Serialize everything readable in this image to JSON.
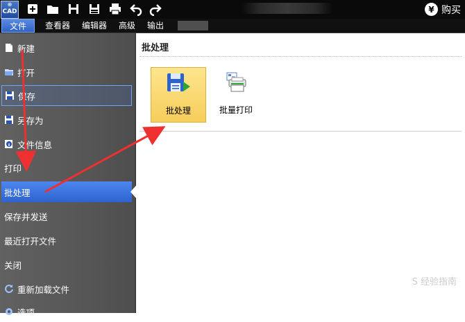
{
  "titlebar": {
    "logo_top": "⊕",
    "logo_text": "CAD",
    "buy_symbol": "¥",
    "buy_label": "购买",
    "icons": [
      "new-icon",
      "open-icon",
      "save-icon",
      "save-as-icon",
      "print-icon",
      "undo-icon",
      "redo-icon"
    ]
  },
  "menubar": {
    "items": [
      "文件",
      "查看器",
      "编辑器",
      "高级",
      "输出"
    ]
  },
  "sidebar": {
    "items": [
      {
        "label": "新建",
        "icon": "new-doc-icon"
      },
      {
        "label": "打开",
        "icon": "folder-open-icon"
      },
      {
        "label": "保存",
        "icon": "floppy-icon"
      },
      {
        "label": "另存为",
        "icon": "save-as-icon"
      },
      {
        "label": "文件信息",
        "icon": "info-icon"
      },
      {
        "label": "打印"
      },
      {
        "label": "批处理"
      },
      {
        "label": "保存并发送"
      },
      {
        "label": "最近打开文件"
      },
      {
        "label": "关闭"
      },
      {
        "label": "重新加载文件",
        "icon": "reload-icon"
      },
      {
        "label": "选项",
        "icon": "options-icon"
      }
    ]
  },
  "content": {
    "title": "批处理",
    "tiles": [
      {
        "label": "批处理",
        "icon": "batch-save-icon"
      },
      {
        "label": "批量打印",
        "icon": "batch-print-icon"
      }
    ],
    "watermark": "S 经验指南"
  },
  "colors": {
    "accent": "#2f63cc",
    "tile_selected": "#f6cd5a",
    "arrow": "#ee3030"
  }
}
